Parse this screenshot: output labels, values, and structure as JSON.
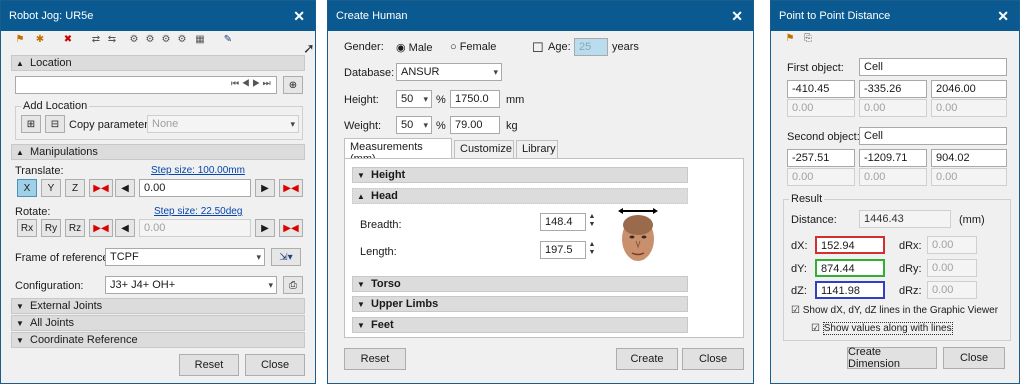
{
  "robot": {
    "title": "Robot Jog: UR5e",
    "close": "✕",
    "location": "Location",
    "add_location": "Add Location",
    "copy_parameters": "Copy parameters:",
    "copy_value": "None",
    "manipulations": "Manipulations",
    "translate": "Translate:",
    "step_translate": "Step size: 100.00mm",
    "translate_value": "0.00",
    "rotate": "Rotate:",
    "step_rotate": "Step size: 22.50deg",
    "rotate_value": "0.00",
    "frame_label": "Frame of reference:",
    "frame_value": "TCPF",
    "config_label": "Configuration:",
    "config_value": "J3+ J4+ OH+",
    "axes_t": [
      "X",
      "Y",
      "Z"
    ],
    "axes_r": [
      "Rx",
      "Ry",
      "Rz"
    ],
    "external": "External Joints",
    "all_joints": "All Joints",
    "coord_ref": "Coordinate Reference",
    "reset": "Reset",
    "close_btn": "Close"
  },
  "human": {
    "title": "Create Human",
    "close": "✕",
    "gender_label": "Gender:",
    "male": "Male",
    "female": "Female",
    "age_label": "Age:",
    "age_value": "25",
    "years": "years",
    "database_label": "Database:",
    "database_value": "ANSUR",
    "height_label": "Height:",
    "height_pct": "50",
    "height_val": "1750.0",
    "height_unit": "mm",
    "weight_label": "Weight:",
    "weight_pct": "50",
    "weight_val": "79.00",
    "weight_unit": "kg",
    "pct": "%",
    "tabs": [
      "Measurements (mm)",
      "Customize",
      "Library"
    ],
    "sections": {
      "height": "Height",
      "head": "Head",
      "torso": "Torso",
      "upper": "Upper Limbs",
      "feet": "Feet"
    },
    "breadth_label": "Breadth:",
    "breadth_val": "148.4",
    "length_label": "Length:",
    "length_val": "197.5",
    "reset": "Reset",
    "create": "Create",
    "close_btn": "Close"
  },
  "p2p": {
    "title": "Point to Point Distance",
    "close": "✕",
    "first_label": "First object:",
    "first_value": "Cell",
    "first": [
      "-410.45",
      "-335.26",
      "2046.00"
    ],
    "first2": [
      "0.00",
      "0.00",
      "0.00"
    ],
    "second_label": "Second object:",
    "second_value": "Cell",
    "second": [
      "-257.51",
      "-1209.71",
      "904.02"
    ],
    "second2": [
      "0.00",
      "0.00",
      "0.00"
    ],
    "result": "Result",
    "distance_label": "Distance:",
    "distance_val": "1446.43",
    "mm": "(mm)",
    "dx": "dX:",
    "dx_val": "152.94",
    "dy": "dY:",
    "dy_val": "874.44",
    "dz": "dZ:",
    "dz_val": "1141.98",
    "drx": "dRx:",
    "drx_val": "0.00",
    "dry": "dRy:",
    "dry_val": "0.00",
    "drz": "dRz:",
    "drz_val": "0.00",
    "show_lines": "Show dX, dY, dZ lines in the Graphic Viewer",
    "show_values": "Show values along with lines",
    "create_dim": "Create Dimension",
    "close_btn": "Close"
  },
  "colors": {
    "title_bar": "#0a5a91",
    "dx": "#d03030",
    "dy": "#30b030",
    "dz": "#3040c0"
  }
}
